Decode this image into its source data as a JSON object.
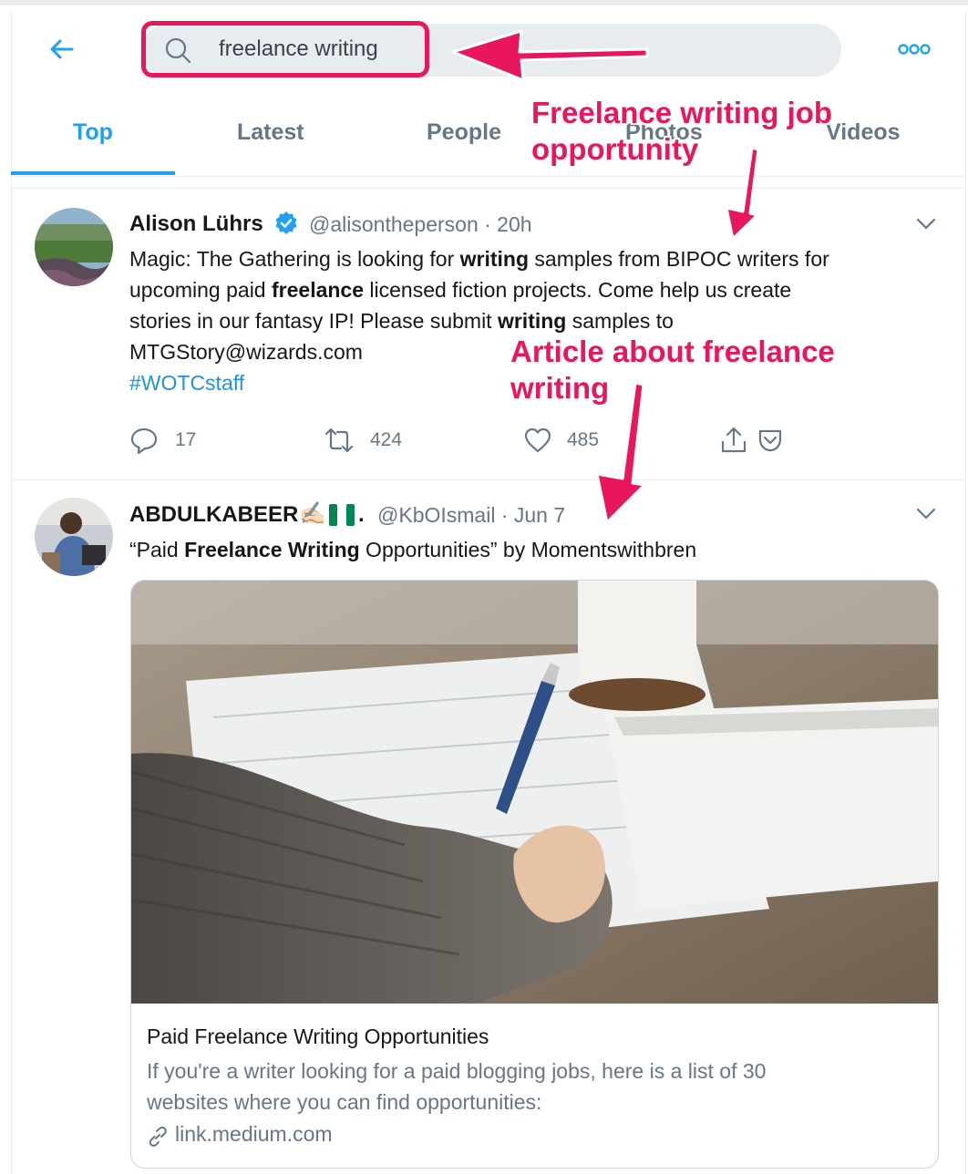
{
  "header": {
    "back_icon": "arrow-left-icon",
    "search_value": "freelance writing",
    "more_icon": "more-dots-icon"
  },
  "tabs": [
    {
      "label": "Top",
      "active": true
    },
    {
      "label": "Latest"
    },
    {
      "label": "People"
    },
    {
      "label": "Photos"
    },
    {
      "label": "Videos"
    }
  ],
  "annotations": {
    "job_line1": "Freelance writing job",
    "job_line2": "opportunity",
    "article_line1": "Article about freelance",
    "article_line2": "writing"
  },
  "tweets": [
    {
      "name": "Alison Lührs",
      "verified": true,
      "handle": "@alisontheperson · 20h",
      "body_lines": [
        "Magic: The Gathering is looking for <b>writing</b> samples from BIPOC writers for",
        "upcoming paid <b>freelance</b> licensed fiction projects. Come help us create",
        "stories in our fantasy IP! Please submit <b>writing</b> samples to",
        "MTGStory@wizards.com"
      ],
      "hashtag": "#WOTCstaff",
      "replies": "17",
      "retweets": "424",
      "likes": "485"
    },
    {
      "name": "ABDULKABEER",
      "name_emoji": "✍🏻",
      "flag_colors": [
        "#008751",
        "#ffffff",
        "#008751"
      ],
      "name_suffix": ".",
      "handle": "@KbOIsmail · Jun 7",
      "body_line": "“Paid <b>Freelance Writing</b> Opportunities” by Momentswithbren",
      "card": {
        "title": "Paid Freelance Writing Opportunities",
        "desc_line1": "If you're a writer looking for a paid blogging jobs, here is a list of 30",
        "desc_line2": "websites where you can find opportunities:",
        "link": "link.medium.com",
        "link_icon": "link-icon"
      }
    }
  ],
  "colors": {
    "accent": "#1da1f2",
    "annotation": "#e8175d",
    "muted": "#657786"
  }
}
